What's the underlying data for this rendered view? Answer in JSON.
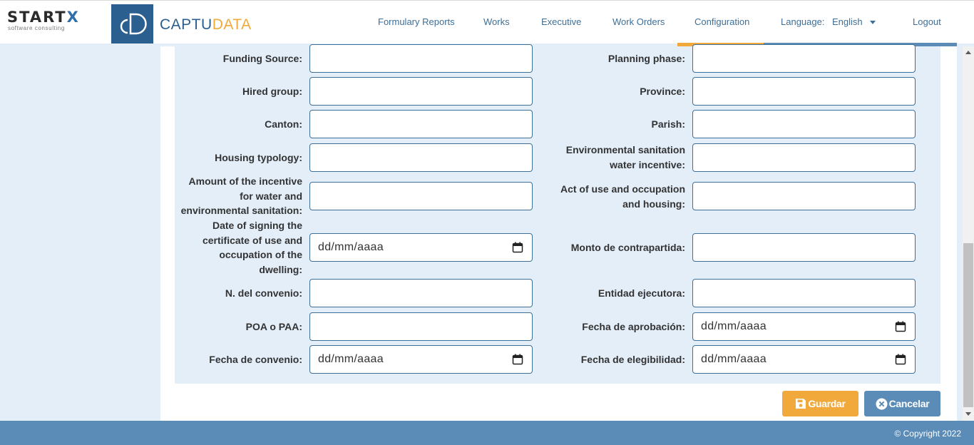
{
  "header": {
    "startx_brand": "STARTX",
    "startx_tagline": "software consulting",
    "app_name_part1": "CAPTU",
    "app_name_part2": "DATA",
    "nav": [
      "Formulary Reports",
      "Works",
      "Executive",
      "Work Orders",
      "Configuration"
    ],
    "language_label": "Language:",
    "language_value": "English",
    "logout": "Logout"
  },
  "form": {
    "left": [
      {
        "label": "Funding Source:",
        "type": "text",
        "value": ""
      },
      {
        "label": "Hired group:",
        "type": "text",
        "value": ""
      },
      {
        "label": "Canton:",
        "type": "text",
        "value": ""
      },
      {
        "label": "Housing typology:",
        "type": "text",
        "value": ""
      },
      {
        "label": "Amount of the incentive for water and environmental sanitation:",
        "type": "text",
        "value": ""
      },
      {
        "label": "Date of signing the certificate of use and occupation of the dwelling:",
        "type": "date",
        "value": "dd/mm/aaaa"
      },
      {
        "label": "N. del convenio:",
        "type": "text",
        "value": ""
      },
      {
        "label": "POA o PAA:",
        "type": "text",
        "value": ""
      },
      {
        "label": "Fecha de convenio:",
        "type": "date",
        "value": "dd/mm/aaaa"
      }
    ],
    "right": [
      {
        "label": "Planning phase:",
        "type": "text",
        "value": ""
      },
      {
        "label": "Province:",
        "type": "text",
        "value": ""
      },
      {
        "label": "Parish:",
        "type": "text",
        "value": ""
      },
      {
        "label": "Environmental sanitation water incentive:",
        "type": "text",
        "value": ""
      },
      {
        "label": "Act of use and occupation and housing:",
        "type": "text",
        "value": ""
      },
      {
        "label": "Monto de contrapartida:",
        "type": "text",
        "value": ""
      },
      {
        "label": "Entidad ejecutora:",
        "type": "text",
        "value": ""
      },
      {
        "label": "Fecha de aprobación:",
        "type": "date",
        "value": "dd/mm/aaaa"
      },
      {
        "label": "Fecha de elegibilidad:",
        "type": "date",
        "value": "dd/mm/aaaa"
      }
    ]
  },
  "buttons": {
    "save": "Guardar",
    "cancel": "Cancelar"
  },
  "footer": {
    "copyright": "© Copyright 2022"
  },
  "colors": {
    "primary": "#5b8cb7",
    "accent": "#f2a93b",
    "background": "#e3eef9"
  }
}
